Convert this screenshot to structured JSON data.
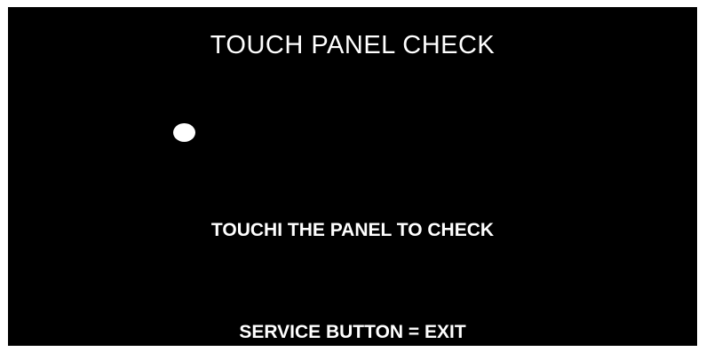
{
  "screen": {
    "title": "TOUCH PANEL CHECK",
    "instruction": "TOUCHI THE PANEL TO CHECK",
    "exit_hint": "SERVICE BUTTON = EXIT",
    "touch_marker_icon": "filled-circle",
    "background_color": "#000000",
    "text_color": "#ffffff"
  }
}
